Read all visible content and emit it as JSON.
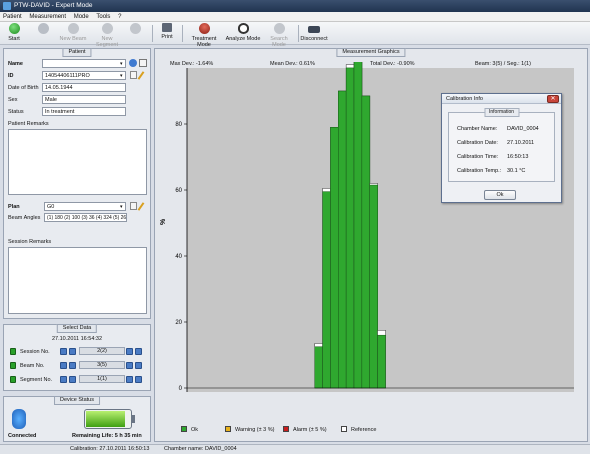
{
  "window": {
    "title": "PTW-DAVID - Expert Mode"
  },
  "menu": [
    "Patient",
    "Measurement",
    "Mode",
    "Tools",
    "?"
  ],
  "toolbar": {
    "start": "Start",
    "new_beam": "New Beam",
    "new_segment": "New Segment",
    "print": "Print",
    "treatment_mode": "Treatment Mode",
    "analyze_mode": "Analyze Mode",
    "search_mode": "Search Mode",
    "disconnect": "Disconnect"
  },
  "patient": {
    "section_title": "Patient",
    "name_label": "Name",
    "name_value": "",
    "id_label": "ID",
    "id_value": "14054406111PRO",
    "dob_label": "Date of Birth",
    "dob_value": "14.05.1944",
    "sex_label": "Sex",
    "sex_value": "Male",
    "status_label": "Status",
    "status_value": "In treatment",
    "remarks_label": "Patient Remarks",
    "plan_label": "Plan",
    "plan_value": "G0",
    "beam_angles_label": "Beam Angles",
    "beam_angles_value": "(1) 180 (2) 100 (3) 36 (4) 324 (5) 260",
    "session_remarks_label": "Session Remarks"
  },
  "select_data": {
    "title": "Select Data",
    "datetime": "27.10.2011 16:54:32",
    "rows": [
      {
        "label": "Session No.",
        "value": "2(2)"
      },
      {
        "label": "Beam No.",
        "value": "3(5)"
      },
      {
        "label": "Segment No.",
        "value": "1(1)"
      }
    ]
  },
  "device_status": {
    "title": "Device Status",
    "connection": "Connected",
    "battery": "Remaining Life: 5 h 35 min",
    "battery_level": 0.85
  },
  "graphics": {
    "title": "Measurement Graphics",
    "max_dev": "Max Dev.: -1.64%",
    "mean_dev": "Mean Dev.: 0.61%",
    "total_dev": "Total Dev.: -0.90%",
    "beam_seg": "Beam: 3(5) / Seg.: 1(1)"
  },
  "chart_data": {
    "type": "bar",
    "xlabel": "Leaf pair",
    "ylabel": "%",
    "x_left_label": "T",
    "x_right_label": "G",
    "ylim": [
      0,
      100
    ],
    "yticks": [
      0,
      20,
      40,
      60,
      80,
      100
    ],
    "categories": [
      "1",
      "2",
      "3",
      "4",
      "5",
      "6",
      "7",
      "8",
      "9",
      "10",
      "11",
      "12",
      "13",
      "14",
      "15",
      "16",
      "17",
      "18",
      "19",
      "20",
      "21",
      "22",
      "23",
      "24",
      "25",
      "26",
      "27",
      "28",
      "29",
      "30",
      "31",
      "32",
      "33",
      "34",
      "35",
      "36",
      "37",
      "38",
      "39",
      "40"
    ],
    "series": [
      {
        "name": "Reference",
        "values": [
          0,
          0,
          0,
          0,
          0,
          0,
          0,
          0,
          0,
          0,
          0,
          0,
          0,
          0,
          0,
          13.5,
          60.5,
          79,
          90,
          98,
          100,
          88.5,
          62,
          17.5,
          0,
          0,
          0,
          0,
          0,
          0,
          0,
          0,
          0,
          0,
          0,
          0,
          0,
          0,
          0,
          0
        ]
      },
      {
        "name": "Ok",
        "values": [
          0,
          0,
          0,
          0,
          0,
          0,
          0,
          0,
          0,
          0,
          0,
          0,
          0,
          0,
          0,
          12.5,
          59.5,
          79,
          90,
          97,
          99.5,
          88.5,
          61.5,
          16,
          0,
          0,
          0,
          0,
          0,
          0,
          0,
          0,
          0,
          0,
          0,
          0,
          0,
          0,
          0,
          0
        ]
      }
    ],
    "legend": [
      "Ok",
      "Warning (± 3 %)",
      "Alarm (± 5 %)",
      "Reference"
    ],
    "colors": {
      "ok": "#2fa82f",
      "warning": "#e8b21c",
      "alarm": "#c81e1e",
      "reference": "#ffffff",
      "plot_bg": "#c6c6c6"
    }
  },
  "calibration": {
    "title": "Calibration Info",
    "section": "Information",
    "rows": [
      {
        "label": "Chamber Name:",
        "value": "DAVID_0004"
      },
      {
        "label": "Calibration Date:",
        "value": "27.10.2011"
      },
      {
        "label": "Calibration Time:",
        "value": "16:50:13"
      },
      {
        "label": "Calibration Temp.:",
        "value": "30.1 °C"
      }
    ],
    "ok": "Ok"
  },
  "statusbar": {
    "calibration": "Calibration: 27.10.2011 16:50:13",
    "chamber": "Chamber name: DAVID_0004"
  }
}
